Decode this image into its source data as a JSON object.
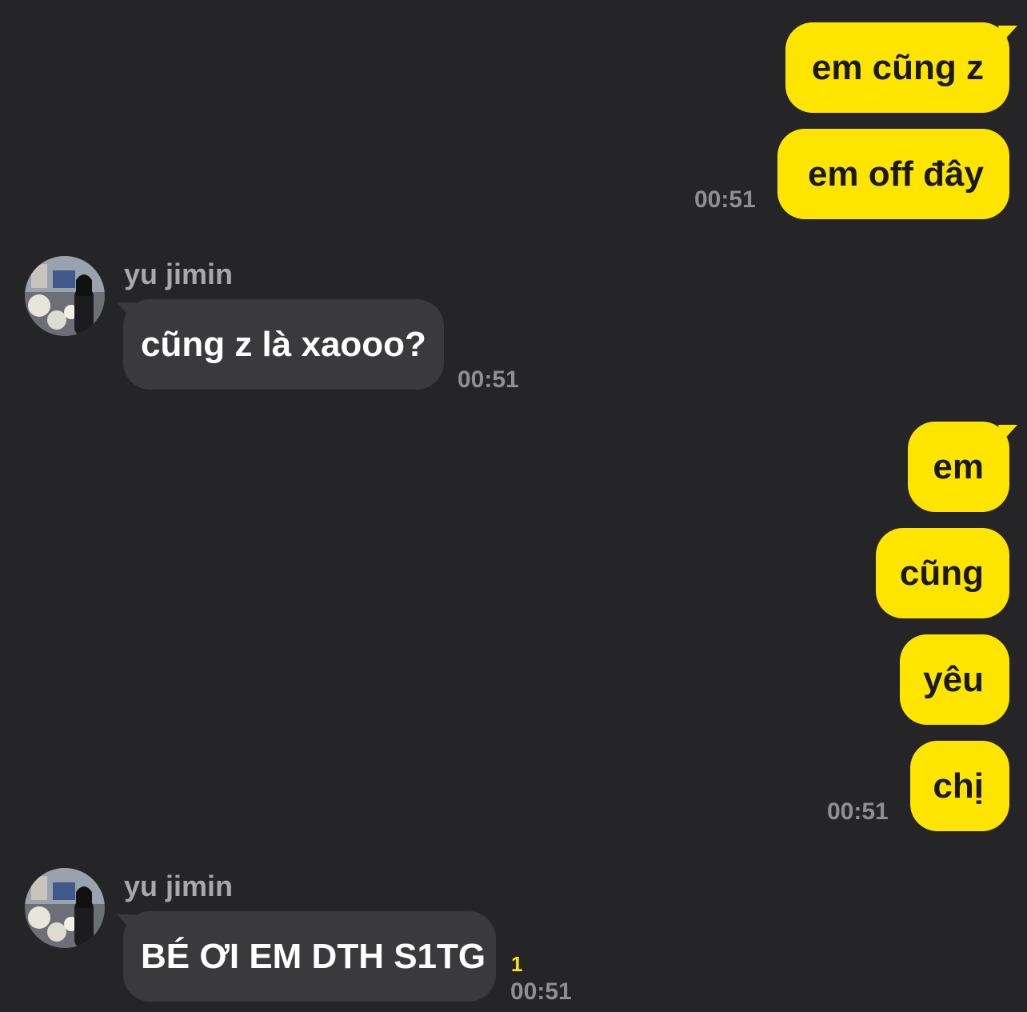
{
  "conversation": {
    "contact_name": "yu jimin",
    "blocks": [
      {
        "sender": "me",
        "messages": [
          "em cũng z",
          "em off đây"
        ],
        "time": "00:51"
      },
      {
        "sender": "them",
        "name": "yu jimin",
        "messages": [
          "cũng z là xaooo?"
        ],
        "time": "00:51"
      },
      {
        "sender": "me",
        "messages": [
          "em",
          "cũng",
          "yêu",
          "chị"
        ],
        "time": "00:51"
      },
      {
        "sender": "them",
        "name": "yu jimin",
        "messages": [
          "BÉ ƠI EM DTH S1TG"
        ],
        "unread_count": "1",
        "time": "00:51"
      }
    ]
  },
  "colors": {
    "background": "#252527",
    "outgoing_bubble": "#FEE500",
    "incoming_bubble": "#3A3A3C",
    "timestamp": "#8E8E93",
    "unread": "#FEE500"
  },
  "icons": {
    "avatar": "contact-profile-photo"
  }
}
